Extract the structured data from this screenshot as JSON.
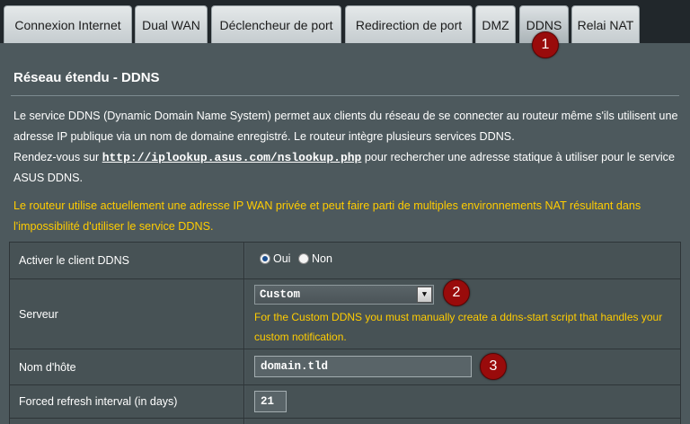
{
  "tabs": [
    {
      "label": "Connexion Internet"
    },
    {
      "label": "Dual WAN"
    },
    {
      "label": "Déclencheur de port"
    },
    {
      "label": "Redirection de port"
    },
    {
      "label": "DMZ"
    },
    {
      "label": "DDNS"
    },
    {
      "label": "Relai NAT"
    }
  ],
  "active_tab": "DDNS",
  "badges": [
    "1",
    "2",
    "3"
  ],
  "page": {
    "title": "Réseau étendu - DDNS",
    "desc1": "Le service DDNS (Dynamic Domain Name System) permet aux clients du réseau de se connecter au routeur même s'ils utilisent une adresse IP publique via un nom de domaine enregistré. Le routeur intègre plusieurs services DDNS.",
    "desc2_before": "Rendez-vous sur ",
    "desc2_link": "http://iplookup.asus.com/nslookup.php",
    "desc2_after": " pour rechercher une adresse statique à utiliser pour le service ASUS DDNS.",
    "warning": "Le routeur utilise actuellement une adresse IP WAN privée et peut faire parti de multiples environnements NAT résultant dans l'impossibilité d'utiliser le service DDNS."
  },
  "form": {
    "enable": {
      "label": "Activer le client DDNS",
      "yes": "Oui",
      "no": "Non",
      "selected": "Oui"
    },
    "server": {
      "label": "Serveur",
      "value": "Custom",
      "note": "For the Custom DDNS you must manually create a ddns-start script that handles your custom notification."
    },
    "hostname": {
      "label": "Nom d'hôte",
      "value": "domain.tld"
    },
    "refresh": {
      "label": "Forced refresh interval (in days)",
      "value": "21"
    }
  },
  "colors": {
    "accent_warning": "#ffcc00",
    "badge": "#990b0b",
    "panel": "#4d595d"
  }
}
